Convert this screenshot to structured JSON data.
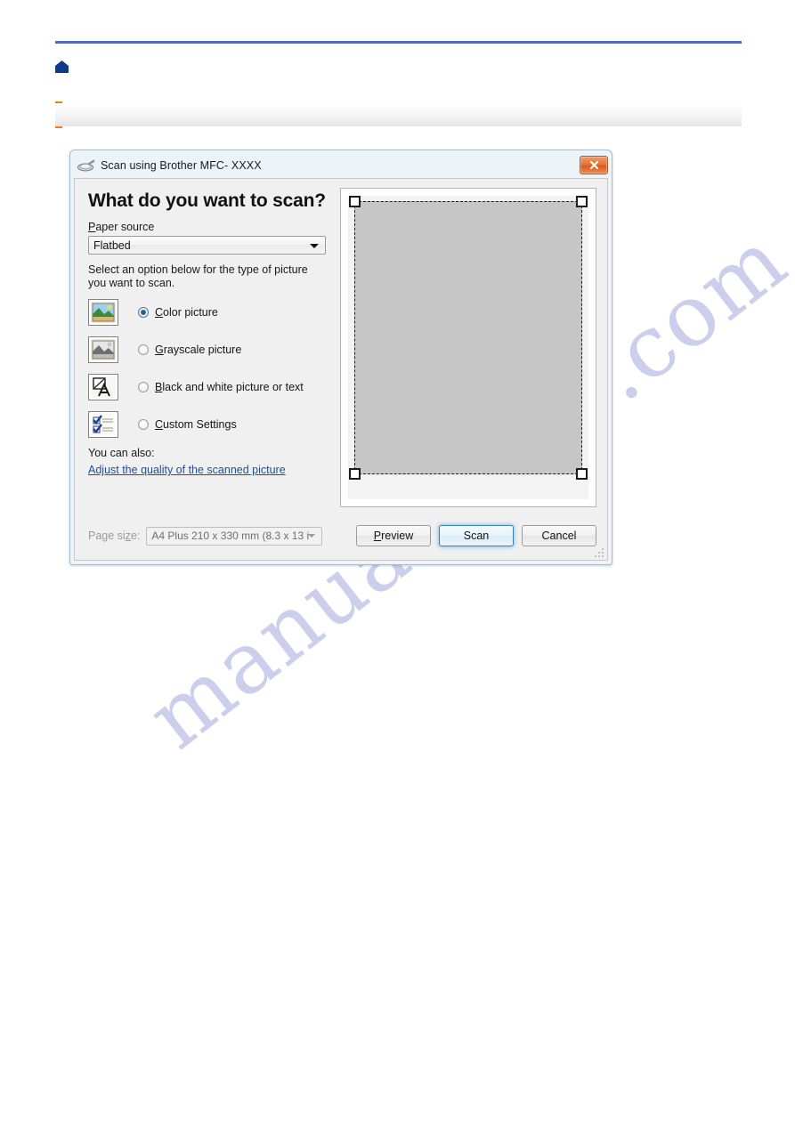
{
  "page": {
    "section_title": "",
    "home_icon": "home-icon",
    "watermark": "manualshive.com",
    "accent_rule_color": "#5269c0",
    "accent_marker_color": "#f57c10"
  },
  "dialog": {
    "title": "Scan using Brother MFC- XXXX",
    "title_icon": "scanner-icon",
    "close_label": "✕",
    "heading": "What do you want to scan?",
    "paper_source": {
      "label_prefix": "P",
      "label_rest": "aper source",
      "value": "Flatbed",
      "options": [
        "Flatbed"
      ]
    },
    "instruction": "Select an option below for the type of picture you want to scan.",
    "options": [
      {
        "icon": "color-picture-icon",
        "akey": "C",
        "label_rest": "olor picture",
        "label_prefix": "C",
        "selected": true
      },
      {
        "icon": "grayscale-picture-icon",
        "akey": "G",
        "label_rest": "rayscale picture",
        "label_prefix": "G",
        "selected": false
      },
      {
        "icon": "black-white-picture-icon",
        "akey": "B",
        "label_rest": "lack and white picture or text",
        "label_prefix": "B",
        "selected": false
      },
      {
        "icon": "custom-settings-icon",
        "akey": "C",
        "label_rest": "ustom Settings",
        "label_prefix": "C",
        "selected": false
      }
    ],
    "you_can_also": "You can also:",
    "quality_link": "Adjust the quality of the scanned picture",
    "page_size": {
      "label": "Page si",
      "label_akey": "z",
      "label_suffix": "e:",
      "value": "A4 Plus 210 x 330 mm (8.3 x 13 i",
      "disabled": true
    },
    "buttons": {
      "preview_prefix": "P",
      "preview_rest": "review",
      "scan": "Scan",
      "cancel": "Cancel",
      "default_button": "scan"
    },
    "preview": {
      "selection_present": true,
      "handles": 4,
      "selection_fill": "#c6c6c6"
    }
  }
}
